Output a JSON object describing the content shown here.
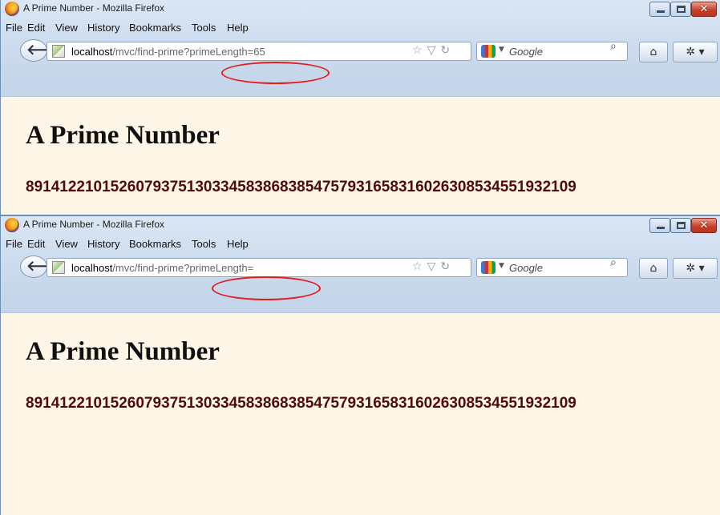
{
  "windows": [
    {
      "title": "A Prime Number - Mozilla Firefox",
      "menu": [
        "File",
        "Edit",
        "View",
        "History",
        "Bookmarks",
        "Tools",
        "Help"
      ],
      "url": {
        "host": "localhost",
        "rest": "/mvc/find-prime?primeLength=65"
      },
      "search": {
        "engine_icon": "google-icon",
        "placeholder": "Google"
      },
      "content": {
        "heading": "A Prime Number",
        "prime": "8914122101526079375130334583868385475793165831602630853455193210​9"
      }
    },
    {
      "title": "A Prime Number - Mozilla Firefox",
      "menu": [
        "File",
        "Edit",
        "View",
        "History",
        "Bookmarks",
        "Tools",
        "Help"
      ],
      "url": {
        "host": "localhost",
        "rest": "/mvc/find-prime?primeLength="
      },
      "search": {
        "engine_icon": "google-icon",
        "placeholder": "Google"
      },
      "content": {
        "heading": "A Prime Number",
        "prime": "8914122101526079375130334583868385475793165831602630853455193210​9"
      }
    }
  ],
  "colors": {
    "page_background": "#fdf5e6",
    "prime_text": "#500a0a",
    "highlight_ring": "#e31b1b",
    "chrome_blue": "#cddcee"
  },
  "icons": {
    "back": "back-arrow-icon",
    "bookmark": "bookmark-star-icon",
    "history_drop": "dropdown-arrow-icon",
    "reload": "reload-icon",
    "search": "magnifier-icon",
    "home": "home-icon",
    "addon": "addon-icon"
  }
}
